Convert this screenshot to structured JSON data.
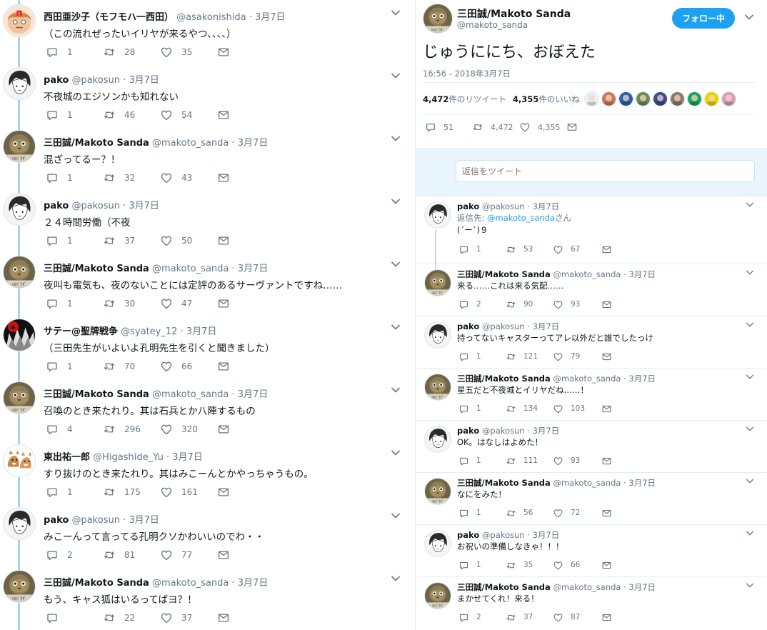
{
  "left_thread": [
    {
      "name": "西田亜沙子（モフモハ一西田）",
      "handle": "@asakonishida",
      "date": "3月7日",
      "text": "（この流れぜったいイリヤが来るやつ、、、、）",
      "replies": "1",
      "retweets": "28",
      "likes": "35",
      "avatar": "girl"
    },
    {
      "name": "pako",
      "handle": "@pakosun",
      "date": "3月7日",
      "text": "不夜城のエジソンかも知れない",
      "replies": "1",
      "retweets": "46",
      "likes": "54",
      "avatar": "pako"
    },
    {
      "name": "三田誠/Makoto Sanda",
      "handle": "@makoto_sanda",
      "date": "3月7日",
      "text": "混ざってるー？！",
      "replies": "1",
      "retweets": "32",
      "likes": "43",
      "avatar": "sanda"
    },
    {
      "name": "pako",
      "handle": "@pakosun",
      "date": "3月7日",
      "text": "２４時間労働（不夜",
      "replies": "1",
      "retweets": "37",
      "likes": "50",
      "avatar": "pako"
    },
    {
      "name": "三田誠/Makoto Sanda",
      "handle": "@makoto_sanda",
      "date": "3月7日",
      "text": "夜叫も電気も、夜のないことには定評のあるサーヴァントですね……",
      "replies": "1",
      "retweets": "30",
      "likes": "47",
      "avatar": "sanda"
    },
    {
      "name": "サテー@聖牌戦争",
      "handle": "@syatey_12",
      "date": "3月7日",
      "text": "（三田先生がいよいよ孔明先生を引くと聞きました）",
      "replies": "1",
      "retweets": "70",
      "likes": "66",
      "avatar": "satay"
    },
    {
      "name": "三田誠/Makoto Sanda",
      "handle": "@makoto_sanda",
      "date": "3月7日",
      "text": "召喚のとき来たれり。其は石兵とか八陣するもの",
      "replies": "4",
      "retweets": "296",
      "likes": "320",
      "avatar": "sanda"
    },
    {
      "name": "東出祐一郎",
      "handle": "@Higashide_Yu",
      "date": "3月7日",
      "text": "すり抜けのとき来たれり。其はみこーんとかやっちゃうもの。",
      "replies": "1",
      "retweets": "175",
      "likes": "161",
      "avatar": "dogs"
    },
    {
      "name": "pako",
      "handle": "@pakosun",
      "date": "3月7日",
      "text": "みこーんって言ってる孔明クソかわいいのでわ・・",
      "replies": "2",
      "retweets": "81",
      "likes": "77",
      "avatar": "pako"
    },
    {
      "name": "三田誠/Makoto Sanda",
      "handle": "@makoto_sanda",
      "date": "3月7日",
      "text": "もう、キャス狐はいるってばヨ？！",
      "replies": "",
      "retweets": "22",
      "likes": "37",
      "avatar": "sanda"
    }
  ],
  "main_tweet": {
    "name": "三田誠/Makoto Sanda",
    "handle": "@makoto_sanda",
    "follow_label": "フォロー中",
    "text": "じゅうににち、おぼえた",
    "timestamp": "16:56 - 2018年3月7日",
    "retweet_count": "4,472",
    "retweet_label": "件のリツイート",
    "like_count": "4,355",
    "like_label": "件のいいね",
    "replies": "51",
    "retweets": "4,472",
    "likes": "4,355",
    "likers": [
      "#e8f0f8",
      "#c77a5a",
      "#2b5fa8",
      "#6a8a5a",
      "#3a4a8a",
      "#8a7a6a",
      "#1aa35a",
      "#f0d000",
      "#d8a0b8"
    ]
  },
  "reply_box": {
    "placeholder": "返信をツイート"
  },
  "right_replies": [
    {
      "name": "pako",
      "handle": "@pakosun",
      "date": "3月7日",
      "reply_prefix": "返信先: ",
      "reply_mention": "@makoto_sanda",
      "reply_suffix": "さん",
      "text": "(´ー`)９",
      "replies": "1",
      "retweets": "53",
      "likes": "67",
      "avatar": "pako"
    },
    {
      "name": "三田誠/Makoto Sanda",
      "handle": "@makoto_sanda",
      "date": "3月7日",
      "text": "来る……これは来る気配……",
      "replies": "2",
      "retweets": "90",
      "likes": "93",
      "avatar": "sanda"
    },
    {
      "name": "pako",
      "handle": "@pakosun",
      "date": "3月7日",
      "text": "持ってないキャスターってアレ以外だと誰でしたっけ",
      "replies": "1",
      "retweets": "121",
      "likes": "79",
      "avatar": "pako"
    },
    {
      "name": "三田誠/Makoto Sanda",
      "handle": "@makoto_sanda",
      "date": "3月7日",
      "text": "星五だと不夜城とイリヤだね……！",
      "replies": "1",
      "retweets": "134",
      "likes": "103",
      "avatar": "sanda"
    },
    {
      "name": "pako",
      "handle": "@pakosun",
      "date": "3月7日",
      "text": "OK。はなしはよめた！",
      "replies": "1",
      "retweets": "111",
      "likes": "93",
      "avatar": "pako"
    },
    {
      "name": "三田誠/Makoto Sanda",
      "handle": "@makoto_sanda",
      "date": "3月7日",
      "text": "なにをみた！",
      "replies": "1",
      "retweets": "56",
      "likes": "72",
      "avatar": "sanda"
    },
    {
      "name": "pako",
      "handle": "@pakosun",
      "date": "3月7日",
      "text": "お祝いの準備しなきゃ！！！",
      "replies": "1",
      "retweets": "35",
      "likes": "66",
      "avatar": "pako"
    },
    {
      "name": "三田誠/Makoto Sanda",
      "handle": "@makoto_sanda",
      "date": "3月7日",
      "text": "まかせてくれ！来る！",
      "replies": "2",
      "retweets": "37",
      "likes": "87",
      "avatar": "sanda"
    }
  ],
  "colors": {
    "accent": "#1da1f2",
    "muted": "#657786",
    "thread_line": "#a8d3f0"
  }
}
